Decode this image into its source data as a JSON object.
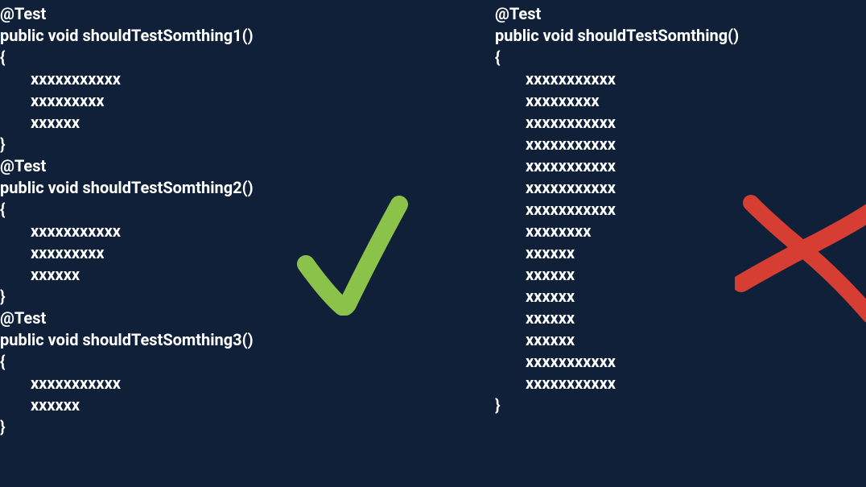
{
  "colors": {
    "background": "#0f2038",
    "text": "#ffffff",
    "check": "#8bc34a",
    "cross": "#d63e33"
  },
  "left": {
    "lines": [
      {
        "text": "@Test",
        "indent": false
      },
      {
        "text": "public void shouldTestSomthing1()",
        "indent": false
      },
      {
        "text": "{",
        "indent": false
      },
      {
        "text": "xxxxxxxxxxx",
        "indent": true
      },
      {
        "text": "xxxxxxxxx",
        "indent": true
      },
      {
        "text": "xxxxxx",
        "indent": true
      },
      {
        "text": "}",
        "indent": false
      },
      {
        "text": "@Test",
        "indent": false
      },
      {
        "text": "public void shouldTestSomthing2()",
        "indent": false
      },
      {
        "text": "{",
        "indent": false
      },
      {
        "text": "xxxxxxxxxxx",
        "indent": true
      },
      {
        "text": "xxxxxxxxx",
        "indent": true
      },
      {
        "text": "xxxxxx",
        "indent": true
      },
      {
        "text": "}",
        "indent": false
      },
      {
        "text": "@Test",
        "indent": false
      },
      {
        "text": "public void shouldTestSomthing3()",
        "indent": false
      },
      {
        "text": "{",
        "indent": false
      },
      {
        "text": "xxxxxxxxxxx",
        "indent": true
      },
      {
        "text": "xxxxxx",
        "indent": true
      },
      {
        "text": "}",
        "indent": false
      }
    ]
  },
  "right": {
    "lines": [
      {
        "text": "@Test",
        "indent": false
      },
      {
        "text": "public void shouldTestSomthing()",
        "indent": false
      },
      {
        "text": "{",
        "indent": false
      },
      {
        "text": "xxxxxxxxxxx",
        "indent": true
      },
      {
        "text": "xxxxxxxxx",
        "indent": true
      },
      {
        "text": "xxxxxxxxxxx",
        "indent": true
      },
      {
        "text": "xxxxxxxxxxx",
        "indent": true
      },
      {
        "text": "xxxxxxxxxxx",
        "indent": true
      },
      {
        "text": "xxxxxxxxxxx",
        "indent": true
      },
      {
        "text": "xxxxxxxxxxx",
        "indent": true
      },
      {
        "text": "xxxxxxxx",
        "indent": true
      },
      {
        "text": "xxxxxx",
        "indent": true
      },
      {
        "text": "xxxxxx",
        "indent": true
      },
      {
        "text": "xxxxxx",
        "indent": true
      },
      {
        "text": "xxxxxx",
        "indent": true
      },
      {
        "text": "xxxxxx",
        "indent": true
      },
      {
        "text": "xxxxxxxxxxx",
        "indent": true
      },
      {
        "text": "xxxxxxxxxxx",
        "indent": true
      },
      {
        "text": "}",
        "indent": false
      }
    ]
  },
  "icons": {
    "check_name": "check-icon",
    "cross_name": "cross-icon"
  }
}
